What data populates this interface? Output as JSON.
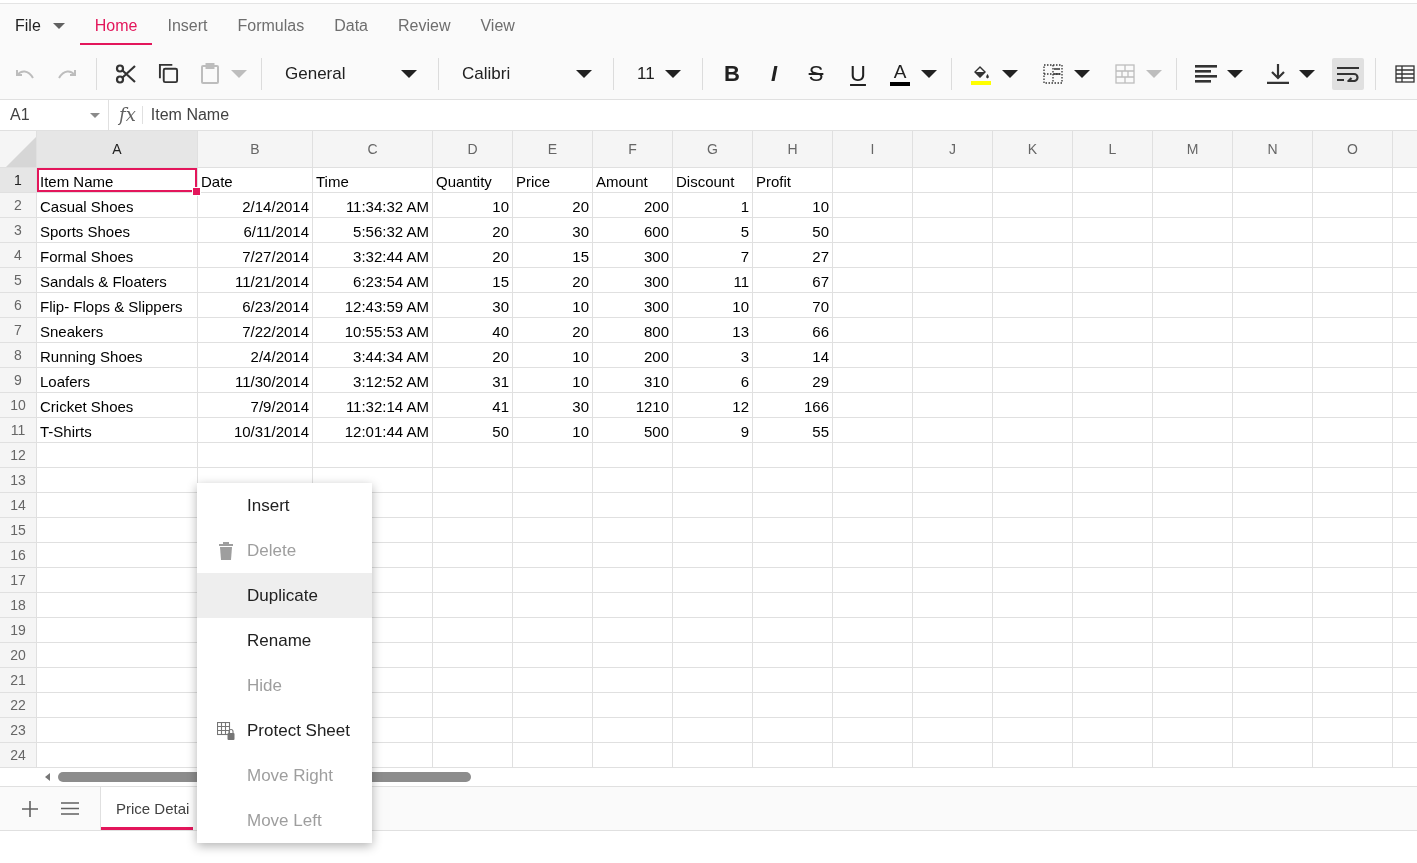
{
  "ribbon_tabs": [
    {
      "label": "File",
      "kind": "menu",
      "selected": false
    },
    {
      "label": "Home",
      "kind": "tab",
      "selected": true
    },
    {
      "label": "Insert",
      "kind": "tab",
      "selected": false
    },
    {
      "label": "Formulas",
      "kind": "tab",
      "selected": false
    },
    {
      "label": "Data",
      "kind": "tab",
      "selected": false
    },
    {
      "label": "Review",
      "kind": "tab",
      "selected": false
    },
    {
      "label": "View",
      "kind": "tab",
      "selected": false
    }
  ],
  "toolbar": {
    "groups": [
      {
        "items": [
          {
            "kind": "undo",
            "disabled": true,
            "dropdown": false
          },
          {
            "kind": "redo",
            "disabled": true,
            "dropdown": false
          }
        ]
      },
      {
        "items": [
          {
            "kind": "cut",
            "disabled": false,
            "dropdown": false
          },
          {
            "kind": "copy",
            "disabled": false,
            "dropdown": false
          },
          {
            "kind": "paste",
            "disabled": true,
            "dropdown": true
          }
        ]
      },
      {
        "items": [
          {
            "kind": "numberformat",
            "value": "General"
          }
        ]
      },
      {
        "items": [
          {
            "kind": "fontname",
            "value": "Calibri"
          }
        ]
      },
      {
        "items": [
          {
            "kind": "fontsize",
            "value": "11"
          }
        ]
      },
      {
        "items": [
          {
            "kind": "bold",
            "label": "B",
            "pressed": false,
            "dropdown": false
          },
          {
            "kind": "italic",
            "label": "I",
            "pressed": false,
            "dropdown": false
          },
          {
            "kind": "strike",
            "label": "S",
            "pressed": false,
            "dropdown": false
          },
          {
            "kind": "underline",
            "label": "U",
            "pressed": false,
            "dropdown": false
          },
          {
            "kind": "fontcolor",
            "label": "A",
            "color": "#000000",
            "dropdown": true
          }
        ]
      },
      {
        "items": [
          {
            "kind": "fillcolor",
            "color": "#ffff00",
            "disabled": false,
            "dropdown": true
          },
          {
            "kind": "borders",
            "disabled": false,
            "dropdown": true
          },
          {
            "kind": "merge",
            "disabled": true,
            "dropdown": true
          }
        ]
      },
      {
        "items": [
          {
            "kind": "align",
            "disabled": false,
            "dropdown": true
          },
          {
            "kind": "valign",
            "disabled": false,
            "dropdown": true
          },
          {
            "kind": "wrap",
            "pressed": true,
            "dropdown": false
          }
        ]
      },
      {
        "items": [
          {
            "kind": "table",
            "disabled": false,
            "dropdown": false
          }
        ]
      }
    ]
  },
  "formula_bar": {
    "name_box": "A1",
    "function_label": "fx",
    "formula": "Item Name"
  },
  "grid": {
    "columns": [
      {
        "label": "A",
        "selected": true
      },
      {
        "label": "B",
        "selected": false
      },
      {
        "label": "C",
        "selected": false
      },
      {
        "label": "D",
        "selected": false
      },
      {
        "label": "E",
        "selected": false
      },
      {
        "label": "F",
        "selected": false
      },
      {
        "label": "G",
        "selected": false
      },
      {
        "label": "H",
        "selected": false
      },
      {
        "label": "I",
        "selected": false
      },
      {
        "label": "J",
        "selected": false
      },
      {
        "label": "K",
        "selected": false
      },
      {
        "label": "L",
        "selected": false
      },
      {
        "label": "M",
        "selected": false
      },
      {
        "label": "N",
        "selected": false
      },
      {
        "label": "O",
        "selected": false
      }
    ],
    "rows": [
      {
        "number": "1",
        "selected": true,
        "cells": [
          "Item Name",
          "Date",
          "Time",
          "Quantity",
          "Price",
          "Amount",
          "Discount",
          "Profit"
        ]
      },
      {
        "number": "2",
        "selected": false,
        "cells": [
          "Casual Shoes",
          "2/14/2014",
          "11:34:32 AM",
          "10",
          "20",
          "200",
          "1",
          "10"
        ]
      },
      {
        "number": "3",
        "selected": false,
        "cells": [
          "Sports Shoes",
          "6/11/2014",
          "5:56:32 AM",
          "20",
          "30",
          "600",
          "5",
          "50"
        ]
      },
      {
        "number": "4",
        "selected": false,
        "cells": [
          "Formal Shoes",
          "7/27/2014",
          "3:32:44 AM",
          "20",
          "15",
          "300",
          "7",
          "27"
        ]
      },
      {
        "number": "5",
        "selected": false,
        "cells": [
          "Sandals & Floaters",
          "11/21/2014",
          "6:23:54 AM",
          "15",
          "20",
          "300",
          "11",
          "67"
        ]
      },
      {
        "number": "6",
        "selected": false,
        "cells": [
          "Flip- Flops & Slippers",
          "6/23/2014",
          "12:43:59 AM",
          "30",
          "10",
          "300",
          "10",
          "70"
        ]
      },
      {
        "number": "7",
        "selected": false,
        "cells": [
          "Sneakers",
          "7/22/2014",
          "10:55:53 AM",
          "40",
          "20",
          "800",
          "13",
          "66"
        ]
      },
      {
        "number": "8",
        "selected": false,
        "cells": [
          "Running Shoes",
          "2/4/2014",
          "3:44:34 AM",
          "20",
          "10",
          "200",
          "3",
          "14"
        ]
      },
      {
        "number": "9",
        "selected": false,
        "cells": [
          "Loafers",
          "11/30/2014",
          "3:12:52 AM",
          "31",
          "10",
          "310",
          "6",
          "29"
        ]
      },
      {
        "number": "10",
        "selected": false,
        "cells": [
          "Cricket Shoes",
          "7/9/2014",
          "11:32:14 AM",
          "41",
          "30",
          "1210",
          "12",
          "166"
        ]
      },
      {
        "number": "11",
        "selected": false,
        "cells": [
          "T-Shirts",
          "10/31/2014",
          "12:01:44 AM",
          "50",
          "10",
          "500",
          "9",
          "55"
        ]
      },
      {
        "number": "12",
        "selected": false
      },
      {
        "number": "13",
        "selected": false
      },
      {
        "number": "14",
        "selected": false
      },
      {
        "number": "15",
        "selected": false
      },
      {
        "number": "16",
        "selected": false
      },
      {
        "number": "17",
        "selected": false
      },
      {
        "number": "18",
        "selected": false
      },
      {
        "number": "19",
        "selected": false
      },
      {
        "number": "20",
        "selected": false
      },
      {
        "number": "21",
        "selected": false
      },
      {
        "number": "22",
        "selected": false
      },
      {
        "number": "23",
        "selected": false
      },
      {
        "number": "24",
        "selected": false
      }
    ]
  },
  "sheet_tabs": [
    {
      "label": "Price Detai",
      "selected": true
    }
  ],
  "context_menu": {
    "items": [
      {
        "label": "Insert",
        "kind": "plain",
        "disabled": false,
        "selected": false
      },
      {
        "label": "Delete",
        "kind": "delete",
        "disabled": true,
        "selected": false
      },
      {
        "label": "Duplicate",
        "kind": "plain",
        "disabled": false,
        "selected": true
      },
      {
        "label": "Rename",
        "kind": "plain",
        "disabled": false,
        "selected": false
      },
      {
        "label": "Hide",
        "kind": "plain",
        "disabled": true,
        "selected": false
      },
      {
        "label": "Protect Sheet",
        "kind": "protect",
        "disabled": false,
        "selected": false
      },
      {
        "label": "Move Right",
        "kind": "plain",
        "disabled": true,
        "selected": false
      },
      {
        "label": "Move Left",
        "kind": "plain",
        "disabled": true,
        "selected": false
      }
    ]
  }
}
